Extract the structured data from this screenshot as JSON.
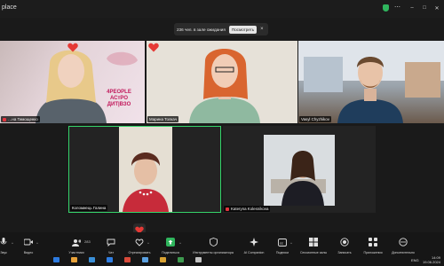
{
  "window": {
    "title": "place"
  },
  "waiting_room": {
    "text": "236 чел. в зале ожидания",
    "view_label": "Посмотреть",
    "close": "×"
  },
  "participants": [
    {
      "name": "…на Тимощенко"
    },
    {
      "name": "Марина Толкач"
    },
    {
      "name": "Vasyl Chyzhikov"
    },
    {
      "name": "Коломиець Галина"
    },
    {
      "name": "Kateryna Kolesnikova"
    }
  ],
  "background_brand": {
    "line1": "4PEOPLE",
    "line2": "АСтРО",
    "line3": "ДИТ|ВЗО"
  },
  "toolbar": {
    "items": [
      {
        "label": "Звук",
        "icon": "microphone-icon"
      },
      {
        "label": "Видео",
        "icon": "video-camera-icon"
      },
      {
        "label": "Участники",
        "icon": "participants-icon",
        "count": "283"
      },
      {
        "label": "Чат",
        "icon": "chat-icon"
      },
      {
        "label": "Отреагировать",
        "icon": "reaction-icon"
      },
      {
        "label": "Поделиться",
        "icon": "share-screen-icon"
      },
      {
        "label": "Инструменты организатора",
        "icon": "host-tools-icon"
      },
      {
        "label": "AI Companion",
        "icon": "ai-companion-icon"
      },
      {
        "label": "Подписи",
        "icon": "captions-icon"
      },
      {
        "label": "Сессионные залы",
        "icon": "breakout-rooms-icon"
      },
      {
        "label": "Записать",
        "icon": "record-icon"
      },
      {
        "label": "Приложения",
        "icon": "apps-icon"
      },
      {
        "label": "Дополнительно",
        "icon": "more-icon"
      }
    ]
  },
  "taskbar": {
    "lang": "ENG",
    "time": "14:09",
    "date": "19.06.2024"
  },
  "colors": {
    "active_speaker": "#35d46a",
    "mic_muted": "#e0353f",
    "heart": "#e53935"
  }
}
